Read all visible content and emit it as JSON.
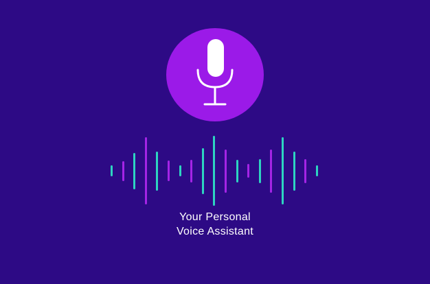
{
  "mic": {
    "icon": "microphone-icon",
    "button_color": "#9b1ae8",
    "icon_color": "#ffffff"
  },
  "background_color": "#2d0a85",
  "waveform": {
    "colors": {
      "teal": "#2ed3c1",
      "purple": "#a524e6"
    },
    "bars": [
      {
        "level": 0.16,
        "color": "teal"
      },
      {
        "level": 0.28,
        "color": "purple"
      },
      {
        "level": 0.52,
        "color": "teal"
      },
      {
        "level": 0.96,
        "color": "purple"
      },
      {
        "level": 0.56,
        "color": "teal"
      },
      {
        "level": 0.29,
        "color": "purple"
      },
      {
        "level": 0.16,
        "color": "teal"
      },
      {
        "level": 0.32,
        "color": "purple"
      },
      {
        "level": 0.66,
        "color": "teal"
      },
      {
        "level": 1.0,
        "color": "teal"
      },
      {
        "level": 0.62,
        "color": "purple"
      },
      {
        "level": 0.32,
        "color": "teal"
      },
      {
        "level": 0.2,
        "color": "purple"
      },
      {
        "level": 0.34,
        "color": "teal"
      },
      {
        "level": 0.62,
        "color": "purple"
      },
      {
        "level": 0.96,
        "color": "teal"
      },
      {
        "level": 0.56,
        "color": "teal"
      },
      {
        "level": 0.34,
        "color": "purple"
      },
      {
        "level": 0.16,
        "color": "teal"
      }
    ]
  },
  "caption": {
    "line1": "Your Personal",
    "line2": "Voice Assistant"
  }
}
